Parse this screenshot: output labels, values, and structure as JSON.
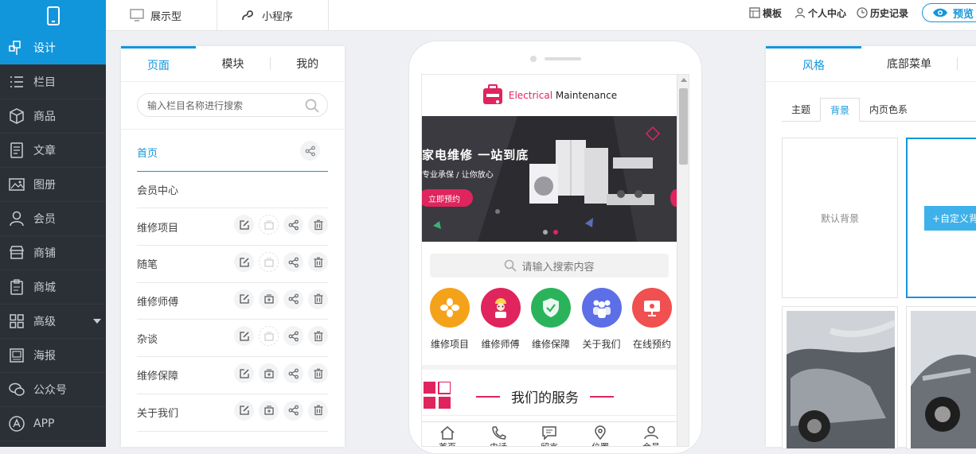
{
  "topbar": {
    "tabs": [
      {
        "label": "展示型",
        "icon": "monitor-icon"
      },
      {
        "label": "小程序",
        "icon": "miniprogram-icon"
      }
    ],
    "right": {
      "template": "模板",
      "user_center": "个人中心",
      "history": "历史记录",
      "preview": "预览"
    }
  },
  "sidebar": {
    "items": [
      {
        "label": "设计",
        "icon": "design-icon"
      },
      {
        "label": "栏目",
        "icon": "list-icon"
      },
      {
        "label": "商品",
        "icon": "box-icon"
      },
      {
        "label": "文章",
        "icon": "article-icon"
      },
      {
        "label": "图册",
        "icon": "image-icon"
      },
      {
        "label": "会员",
        "icon": "user-icon"
      },
      {
        "label": "商铺",
        "icon": "shop-icon"
      },
      {
        "label": "商城",
        "icon": "mall-icon"
      },
      {
        "label": "高级",
        "icon": "grid-icon"
      },
      {
        "label": "海报",
        "icon": "poster-icon"
      },
      {
        "label": "公众号",
        "icon": "wechat-icon"
      },
      {
        "label": "APP",
        "icon": "app-icon"
      }
    ]
  },
  "left_panel": {
    "tabs": [
      "页面",
      "模块",
      "我的"
    ],
    "search_placeholder": "输入栏目名称进行搜索",
    "pages": [
      "首页",
      "会员中心",
      "维修项目",
      "随笔",
      "维修师傅",
      "杂谈",
      "维修保障",
      "关于我们"
    ]
  },
  "phone": {
    "logo": {
      "accent": "Electrical",
      "rest": " Maintenance"
    },
    "banner": {
      "title": "家电维修  一站到底",
      "subtitle": "专业承保 / 让你放心",
      "button": "立即预约"
    },
    "search_placeholder": "请输入搜索内容",
    "quick_links": [
      {
        "label": "维修项目",
        "color": "#f5a21b"
      },
      {
        "label": "维修师傅",
        "color": "#e0245e"
      },
      {
        "label": "维修保障",
        "color": "#2bb35c"
      },
      {
        "label": "关于我们",
        "color": "#5d6fe6"
      },
      {
        "label": "在线预约",
        "color": "#f0504f"
      }
    ],
    "section_title": "我们的服务",
    "bottom_nav": [
      "首页",
      "电话",
      "留言",
      "位置",
      "会员"
    ]
  },
  "right_panel": {
    "tabs": [
      "风格",
      "底部菜单"
    ],
    "subtabs": [
      "主题",
      "背景",
      "内页色系"
    ],
    "default_bg": "默认背景",
    "custom_bg_button": "+自定义背景"
  },
  "colors": {
    "accent": "#1296db",
    "brand": "#e0245e"
  }
}
